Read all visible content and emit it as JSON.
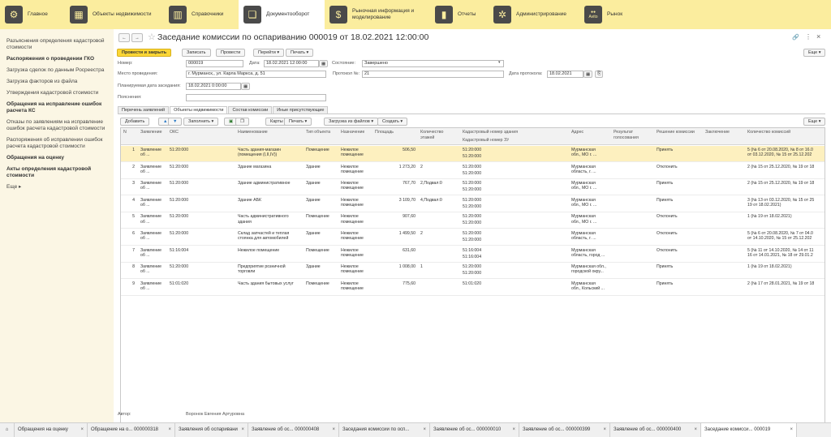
{
  "topnav": [
    {
      "label": "Главное",
      "icon": "gear-icon"
    },
    {
      "label": "Объекты недвижимости",
      "icon": "building-icon"
    },
    {
      "label": "Справочники",
      "icon": "books-icon"
    },
    {
      "label": "Документооборот",
      "icon": "documents-icon"
    },
    {
      "label": "Рыночная информация и моделирование",
      "icon": "money-icon"
    },
    {
      "label": "Отчеты",
      "icon": "chart-icon"
    },
    {
      "label": "Администрирование",
      "icon": "gears-icon"
    },
    {
      "label": "Рынок",
      "icon": "avito-icon",
      "badge": "Avito"
    }
  ],
  "sidebar": [
    {
      "label": "Разъяснения определения кадастровой стоимости",
      "bold": false
    },
    {
      "label": "Распоряжения о проведении ГКО",
      "bold": true
    },
    {
      "label": "Загрузка сделок по данным Росреестра",
      "bold": false
    },
    {
      "label": "Загрузка факторов из файла",
      "bold": false
    },
    {
      "label": "Утверждения кадастровой стоимости",
      "bold": false
    },
    {
      "label": "Обращения на исправление ошибок расчета КС",
      "bold": true
    },
    {
      "label": "Отказы по заявлениям на исправление ошибок расчета кадастровой стоимости",
      "bold": false
    },
    {
      "label": "Распоряжения об исправлении ошибок расчета кадастровой стоимости",
      "bold": false
    },
    {
      "label": "Обращения на оценку",
      "bold": true
    },
    {
      "label": "Акты определения кадастровой стоимости",
      "bold": true
    },
    {
      "label": "Еще ▸",
      "bold": false
    }
  ],
  "doc": {
    "title": "Заседание комиссии по оспариванию 000019 от 18.02.2021 12:00:00",
    "btn_post_close": "Провести и закрыть",
    "btn_save": "Записать",
    "btn_post": "Провести",
    "btn_goto": "Перейти ▾",
    "btn_print": "Печать ▾",
    "btn_more": "Еще ▾",
    "lbl_number": "Номер:",
    "number": "000019",
    "lbl_date": "Дата:",
    "date": "18.02.2021 12:00:00",
    "lbl_state": "Состояние:",
    "state": "Завершено",
    "lbl_place": "Место проведения:",
    "place": "г. Мурманск,, ул. Карла Маркса, д. 51",
    "lbl_protocol": "Протокол №:",
    "protocol": "21",
    "lbl_protocol_date": "Дата протокола:",
    "protocol_date": "18.02.2021",
    "lbl_planned": "Планируемая дата заседания:",
    "planned": "18.02.2021  0:00:00",
    "lbl_notes": "Пояснения:",
    "notes": "",
    "lbl_author": "Автор:",
    "author": "Воронок Евгения Артуровна"
  },
  "tabs": [
    "Перечень заявлений",
    "Объекты недвижимости",
    "Состав комиссии",
    "Иные присутствующие"
  ],
  "active_tab": 1,
  "table_toolbar": {
    "add": "Добавить",
    "fill": "Заполнить ▾",
    "maps": "Карты ▾",
    "print": "Печать ▾",
    "load": "Загрузка из файлов ▾",
    "create": "Создать ▾",
    "more": "Еще ▾"
  },
  "columns": {
    "n": "N",
    "app": "Заявление",
    "oks": "ОКС",
    "name": "Наименование",
    "type": "Тип объекта",
    "purpose": "Назначение",
    "area": "Площадь",
    "floors": "Количество этажей",
    "cad_bld": "Кадастровый номер здания",
    "cad_zu": "Кадастровый номер ЗУ",
    "addr": "Адрес",
    "vote": "Результат голосования",
    "decision": "Решение комиссии",
    "concl": "Заключение",
    "count": "Количество комиссий"
  },
  "rows": [
    {
      "n": "1",
      "app": "Заявление\nоб ...",
      "oks": "51:20:000",
      "name": "Часть здания-магазин\n(помещения (I,II,IV))",
      "type": "Помещение",
      "purpose": "Нежилое\nпомещение",
      "area": "506,50",
      "floors": "",
      "cad_bld": "51:20:000",
      "cad_zu": "51:20:000",
      "addr": "Мурманская\nобл., МО г. ...",
      "vote": "",
      "decision": "Принять",
      "concl": "",
      "count": "5 (№ 6 от 20.08.2020, № 8 от 16.0\nот 03.12.2020, № 15 от 25.12.202"
    },
    {
      "n": "2",
      "app": "Заявление\nоб ...",
      "oks": "51:20:000",
      "name": "Здание магазина",
      "type": "Здание",
      "purpose": "Нежилое\nпомещение",
      "area": "1 273,20",
      "floors": "2",
      "cad_bld": "51:20:000",
      "cad_zu": "51:20:000",
      "addr": "Мурманская\nобласть, г. ...",
      "vote": "",
      "decision": "Отклонить",
      "concl": "",
      "count": "2 (№ 15 от 25.12.2020, № 19 от 18"
    },
    {
      "n": "3",
      "app": "Заявление\nоб ...",
      "oks": "51:20:000",
      "name": "Здание административное",
      "type": "Здание",
      "purpose": "Нежилое\nпомещение",
      "area": "767,70",
      "floors": "2,Подвал:0",
      "cad_bld": "51:20:000",
      "cad_zu": "51:20:000",
      "addr": "Мурманская\nобл., МО г. ...",
      "vote": "",
      "decision": "Принять",
      "concl": "",
      "count": "2 (№ 15 от 25.12.2020, № 19 от 18"
    },
    {
      "n": "4",
      "app": "Заявление\nоб ...",
      "oks": "51:20:000",
      "name": "Здание АБК",
      "type": "Здание",
      "purpose": "Нежилое\nпомещение",
      "area": "3 109,70",
      "floors": "4,Подвал:0",
      "cad_bld": "51:20:000",
      "cad_zu": "51:20:000",
      "addr": "Мурманская\nобл., МО г. ...",
      "vote": "",
      "decision": "Принять",
      "concl": "",
      "count": "3 (№ 13 от 03.12.2020, № 15 от 25\n19 от 18.02.2021)"
    },
    {
      "n": "5",
      "app": "Заявление\nоб ...",
      "oks": "51:20:000",
      "name": "Часть административного\nздания",
      "type": "Помещение",
      "purpose": "Нежилое\nпомещение",
      "area": "907,60",
      "floors": "",
      "cad_bld": "51:20:000",
      "cad_zu": "51:20:000",
      "addr": "Мурманская\nобл., МО г. ...",
      "vote": "",
      "decision": "Отклонить",
      "concl": "",
      "count": "1 (№ 19 от 18.02.2021)"
    },
    {
      "n": "6",
      "app": "Заявление\nоб ...",
      "oks": "51:20:000",
      "name": "Склад запчастей и теплая\nстоянка для автомобилей",
      "type": "Здание",
      "purpose": "Нежилое\nпомещение",
      "area": "1 499,50",
      "floors": "2",
      "cad_bld": "51:20:000",
      "cad_zu": "51:20:000",
      "addr": "Мурманская\nобласть, г. ...",
      "vote": "",
      "decision": "Отклонить",
      "concl": "",
      "count": "5 (№ 6 от 20.08.2020, № 7 от 04.0\nот 14.10.2020, № 15 от 25.12.202"
    },
    {
      "n": "7",
      "app": "Заявление\nоб ...",
      "oks": "51:16:004",
      "name": "Нежилое помещение",
      "type": "Помещение",
      "purpose": "Нежилое\nпомещение",
      "area": "631,60",
      "floors": "",
      "cad_bld": "51:16:004",
      "cad_zu": "51:16:004",
      "addr": "Мурманская\nобласть, город ...",
      "vote": "",
      "decision": "Отклонить",
      "concl": "",
      "count": "5 (№ 11 от 14.10.2020, № 14 от 11\n16 от 14.01.2021, № 18 от 29.01.2"
    },
    {
      "n": "8",
      "app": "Заявление\nоб ...",
      "oks": "51:20:000",
      "name": "Предприятие розничной\nторговли",
      "type": "Здание",
      "purpose": "Нежилое\nпомещение",
      "area": "1 008,00",
      "floors": "1",
      "cad_bld": "51:20:000",
      "cad_zu": "51:20:000",
      "addr": "Мурманская обл.,\nгородской окру...",
      "vote": "",
      "decision": "Принять",
      "concl": "",
      "count": "1 (№ 19 от 18.02.2021)"
    },
    {
      "n": "9",
      "app": "Заявление\nоб ...",
      "oks": "51:01:020",
      "name": "Часть здания бытовых услуг",
      "type": "Помещение",
      "purpose": "Нежилое\nпомещение",
      "area": "775,60",
      "floors": "",
      "cad_bld": "51:01:020",
      "cad_zu": "",
      "addr": "Мурманская\nобл., Кольский ...",
      "vote": "",
      "decision": "Принять",
      "concl": "",
      "count": "2 (№ 17 от 28.01.2021, № 19 от 18"
    }
  ],
  "taskbar": [
    {
      "label": "Обращения на оценку"
    },
    {
      "label": "Обращение на о... 000000318"
    },
    {
      "label": "Заявления об оспаривании"
    },
    {
      "label": "Заявление об ос... 000000408"
    },
    {
      "label": "Заседания комиссии по осп..."
    },
    {
      "label": "Заявление об ос... 000000010"
    },
    {
      "label": "Заявление об ос... 000000399"
    },
    {
      "label": "Заявление об ос... 000000400"
    },
    {
      "label": "Заседание комисси... 000019"
    }
  ],
  "colors": {
    "accent": "#fbd634",
    "topbar": "#fbed9e",
    "sidebar": "#fbf6e4",
    "selected_row": "#fdf0bf"
  }
}
